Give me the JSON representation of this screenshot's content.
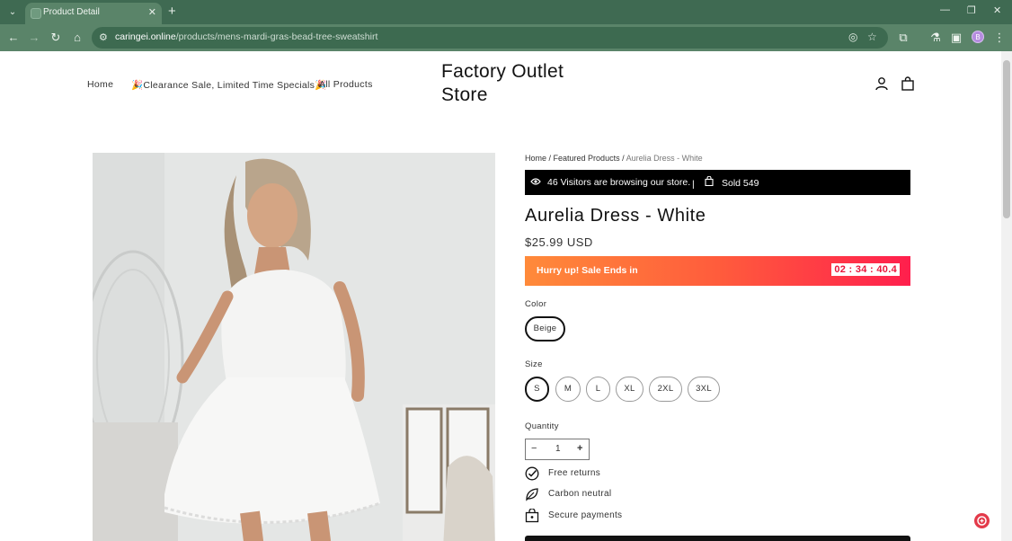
{
  "browser": {
    "tab_title": "Product Detail",
    "url_host": "caringei.online",
    "url_path": "/products/mens-mardi-gras-bead-tree-sweatshirt",
    "profile_initial": "B"
  },
  "header": {
    "nav": [
      "Home",
      "🎉Clearance Sale, Limited Time Specials🎉",
      "All Products"
    ],
    "logo_line1": "Factory Outlet",
    "logo_line2": "Store"
  },
  "breadcrumb": {
    "home": "Home",
    "sep1": " / ",
    "featured": "Featured Products",
    "sep2": " / ",
    "current": "Aurelia Dress - White"
  },
  "visitor_bar": {
    "visitors_text": "46 Visitors are browsing our store.",
    "divider": "|",
    "sold_text": "Sold 549"
  },
  "product": {
    "title": "Aurelia Dress - White",
    "price": "$25.99 USD"
  },
  "sale": {
    "label": "Hurry up! Sale Ends in",
    "timer": "02 : 34 : 40.4"
  },
  "options": {
    "color_label": "Color",
    "colors": [
      "Beige"
    ],
    "size_label": "Size",
    "sizes": [
      "S",
      "M",
      "L",
      "XL",
      "2XL",
      "3XL"
    ],
    "quantity_label": "Quantity",
    "quantity_value": "1",
    "minus": "−",
    "plus": "+"
  },
  "features": [
    "Free returns",
    "Carbon neutral",
    "Secure payments"
  ],
  "colors": {
    "tab_strip": "#3f6a52",
    "toolbar": "#5a8469",
    "sale_gradient_start": "#ff8a3a",
    "sale_gradient_end": "#ff1f4d",
    "timer_text": "#e8153a"
  }
}
